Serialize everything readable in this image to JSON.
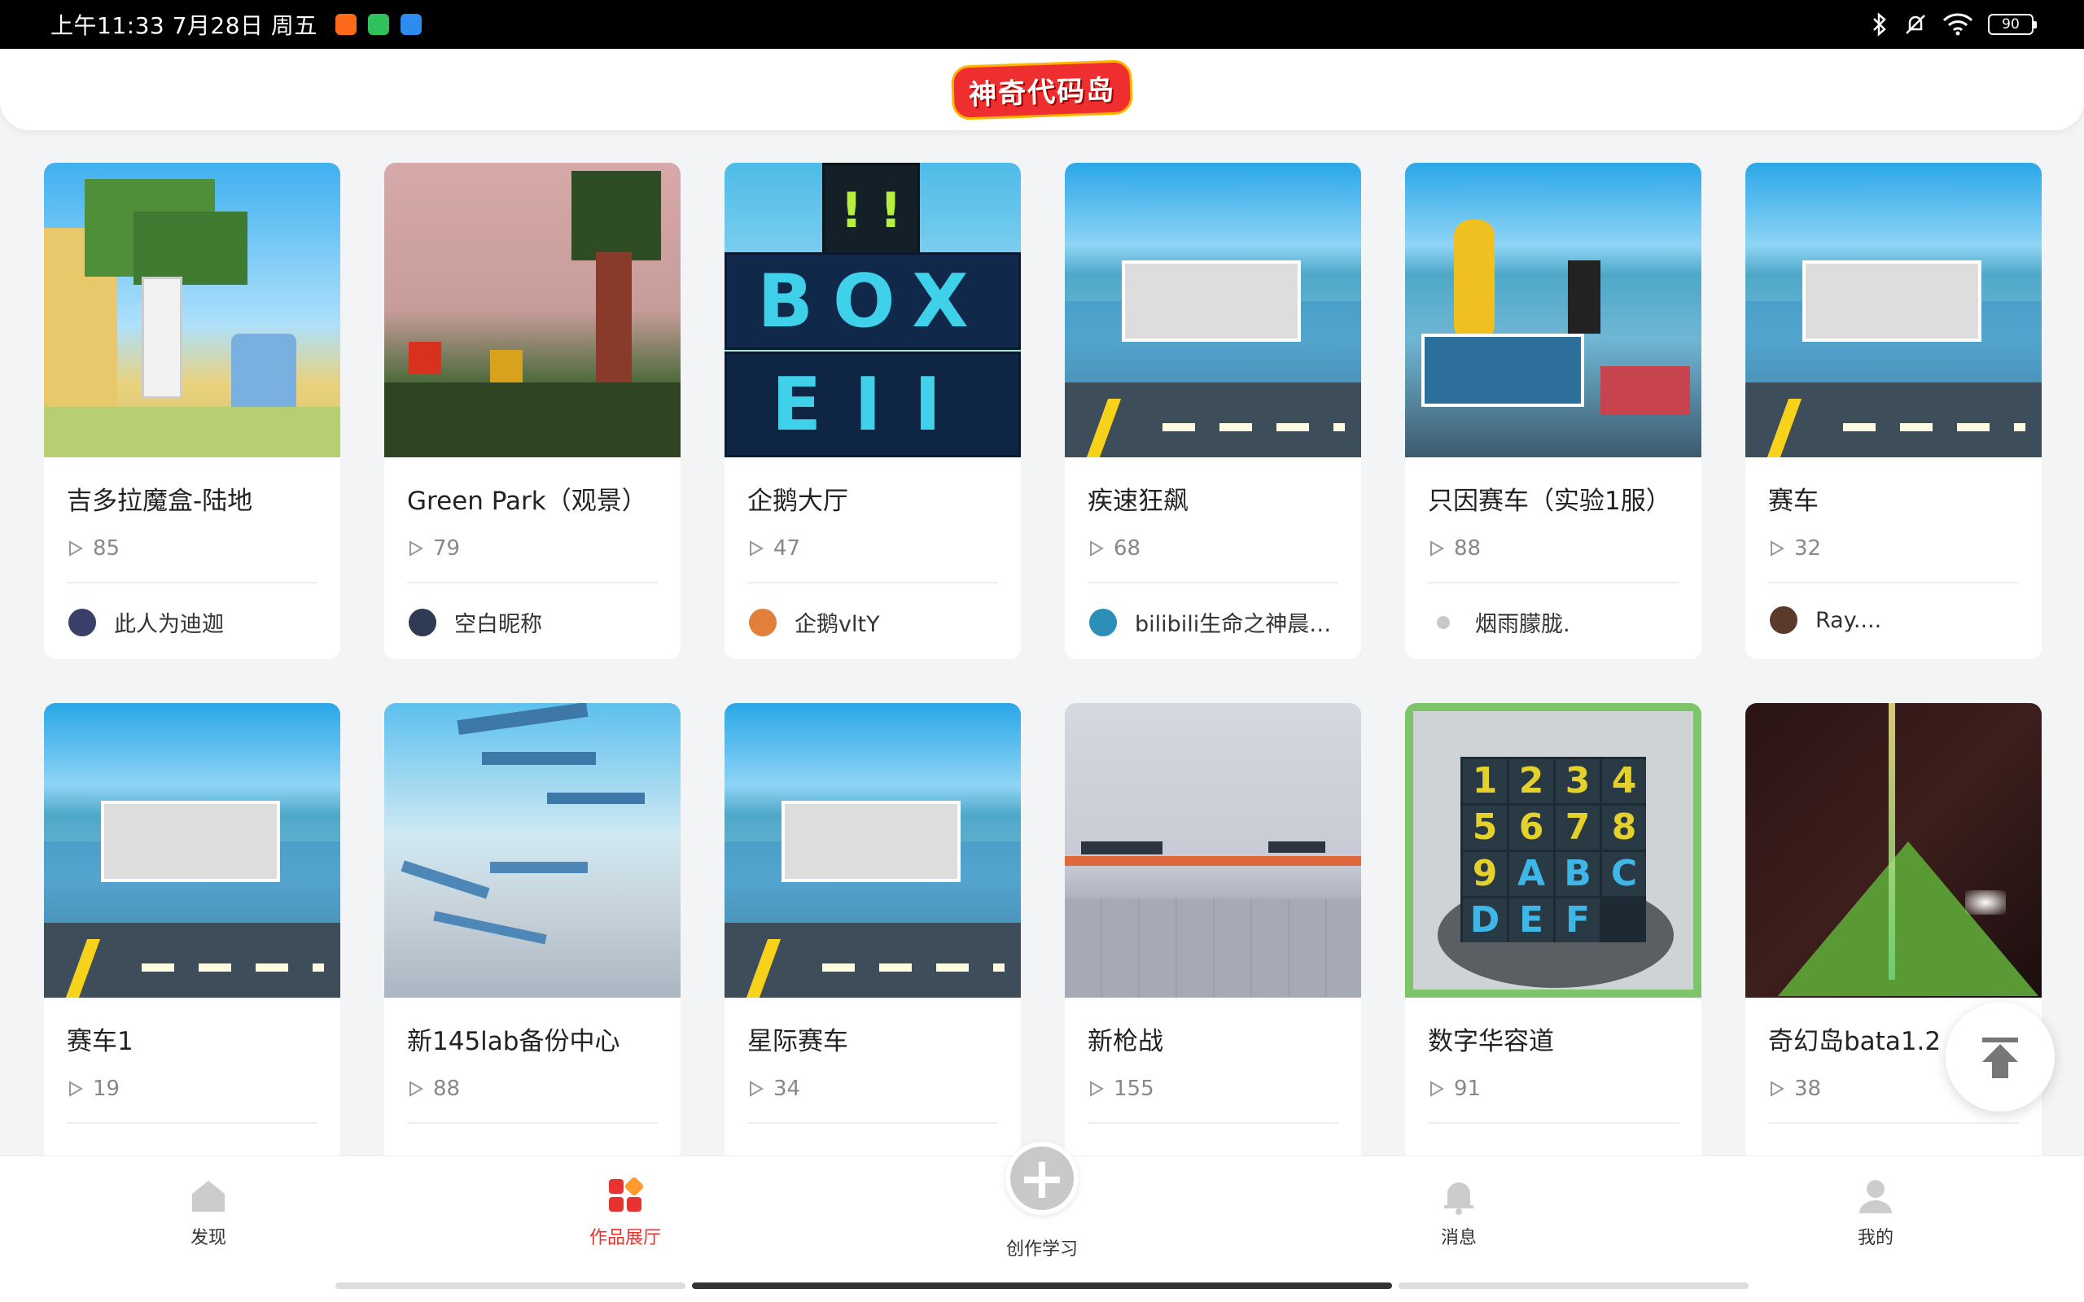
{
  "status_bar": {
    "time": "上午11:33 7月28日 周五",
    "battery": "90",
    "app_icons": [
      "taobao-icon",
      "download-icon",
      "cloud-app-icon"
    ]
  },
  "header": {
    "logo": "神奇代码岛"
  },
  "cards": [
    {
      "title": "吉多拉魔盒-陆地",
      "plays": "85",
      "author": "此人为迪迦"
    },
    {
      "title": "Green Park（观景）",
      "plays": "79",
      "author": "空白昵称"
    },
    {
      "title": "企鹅大厅",
      "plays": "47",
      "author": "企鹅vltY"
    },
    {
      "title": "疾速狂飙",
      "plays": "68",
      "author": "bilibili生命之神晨海..."
    },
    {
      "title": "只因赛车（实验1服）",
      "plays": "88",
      "author": "烟雨朦胧."
    },
    {
      "title": "赛车",
      "plays": "32",
      "author": "Ray...."
    },
    {
      "title": "赛车1",
      "plays": "19",
      "author": ""
    },
    {
      "title": "新145lab备份中心",
      "plays": "88",
      "author": ""
    },
    {
      "title": "星际赛车",
      "plays": "34",
      "author": ""
    },
    {
      "title": "新枪战",
      "plays": "155",
      "author": ""
    },
    {
      "title": "数字华容道",
      "plays": "91",
      "author": ""
    },
    {
      "title": "奇幻岛bata1.2",
      "plays": "38",
      "author": ""
    }
  ],
  "thumb_text": {
    "box_top": "! !",
    "box_mid": "BOX",
    "box_low": "EII",
    "klotski": [
      "1",
      "2",
      "3",
      "4",
      "5",
      "6",
      "7",
      "8",
      "9",
      "A",
      "B",
      "C",
      "D",
      "E",
      "F"
    ]
  },
  "nav": {
    "discover": "发现",
    "gallery": "作品展厅",
    "create": "创作学习",
    "messages": "消息",
    "mine": "我的"
  },
  "colors": {
    "accent": "#e8322f",
    "card_bg": "#ffffff",
    "page_bg": "#f3f4f6"
  }
}
